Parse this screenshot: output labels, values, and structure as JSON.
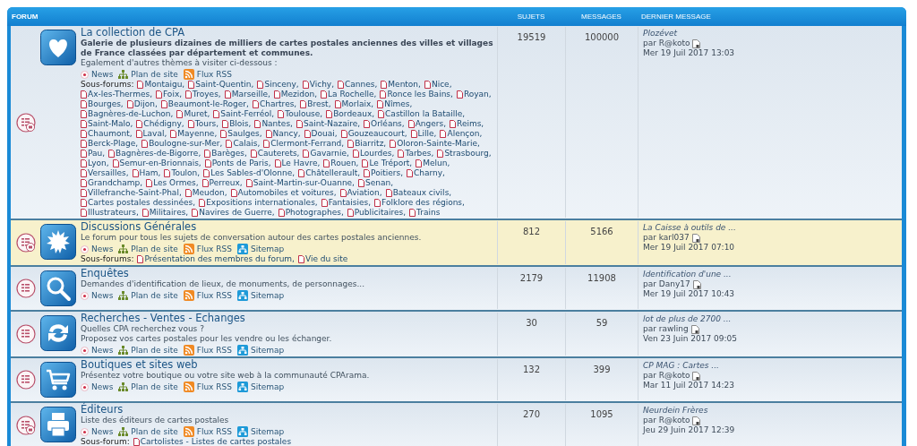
{
  "header": {
    "forum": "FORUM",
    "topics": "SUJETS",
    "posts": "MESSAGES",
    "last_post": "DERNIER MESSAGE"
  },
  "forums": [
    {
      "name": "La collection de CPA",
      "highlighted": false,
      "has_subforums": true,
      "description": [
        {
          "kind": "bold",
          "text": "Galerie de plusieurs dizaines de milliers de cartes postales anciennes des villes et villages de France classées par département et communes."
        },
        {
          "kind": "plain",
          "text": "Egalement d'autres thèmes à visiter ci-dessous :"
        }
      ],
      "links": [
        {
          "kind": "news",
          "label": "News"
        },
        {
          "kind": "plan",
          "label": "Plan de site"
        },
        {
          "kind": "rss",
          "label": "Flux RSS"
        }
      ],
      "subforums_label": "Sous-forums:",
      "subforums": [
        "Montaigu,",
        "Saint-Quentin,",
        "Sinceny,",
        "Vichy,",
        "Cannes,",
        "Menton,",
        "Nice,",
        "Ax-les-Thermes,",
        "Foix,",
        "Troyes,",
        "Marseille,",
        "Mezidon,",
        "La Rochelle,",
        "Ronce les Bains,",
        "Royan,",
        "Bourges,",
        "Dijon,",
        "Beaumont-le-Roger,",
        "Chartres,",
        "Brest,",
        "Morlaix,",
        "Nîmes,",
        "Bagnères-de-Luchon,",
        "Muret,",
        "Saint-Ferréol,",
        "Toulouse,",
        "Bordeaux,",
        "Castillon la Bataille,",
        "Saint-Malo,",
        "Chédigny,",
        "Tours,",
        "Blois,",
        "Nantes,",
        "Saint-Nazaire,",
        "Orléans,",
        "Angers,",
        "Reims,",
        "Chaumont,",
        "Laval,",
        "Mayenne,",
        "Saulges,",
        "Nancy,",
        "Douai,",
        "Gouzeaucourt,",
        "Lille,",
        "Alençon,",
        "Berck-Plage,",
        "Boulogne-sur-Mer,",
        "Calais,",
        "Clermont-Ferrand,",
        "Biarritz,",
        "Oloron-Sainte-Marie,",
        "Pau,",
        "Bagnères-de-Bigorre,",
        "Barèges,",
        "Cauterets,",
        "Gavarnie,",
        "Lourdes,",
        "Tarbes,",
        "Strasbourg,",
        "Lyon,",
        "Semur-en-Brionnais,",
        "Ponts de Paris,",
        "Le Havre,",
        "Rouen,",
        "Le Tréport,",
        "Melun,",
        "Versailles,",
        "Ham,",
        "Toulon,",
        "Les Sables-d'Olonne,",
        "Châtellerault,",
        "Poitiers,",
        "Charny,",
        "Grandchamp,",
        "Les Ormes,",
        "Perreux,",
        "Saint-Martin-sur-Ouanne,",
        "Senan,",
        "Villefranche-Saint-Phal,",
        "Meudon,",
        "Automobiles et voitures,",
        "Aviation,",
        "Bateaux civils,",
        "Cartes postales dessinées,",
        "Expositions internationales,",
        "Fantaisies,",
        "Folklore des régions,",
        "Illustrateurs,",
        "Militaires,",
        "Navires de Guerre,",
        "Photographes,",
        "Publicitaires,",
        "Trains"
      ],
      "topics": "19519",
      "posts": "100000",
      "last": {
        "title": "Plozévet",
        "author": "par R@koto",
        "date": "Mer 19 Juil 2017 13:03"
      }
    },
    {
      "name": "Discussions Générales",
      "highlighted": true,
      "has_subforums": true,
      "description": [
        {
          "kind": "plain",
          "text": "Le forum pour tous les sujets de conversation autour des cartes postales anciennes."
        }
      ],
      "links": [
        {
          "kind": "news",
          "label": "News"
        },
        {
          "kind": "plan",
          "label": "Plan de site"
        },
        {
          "kind": "rss",
          "label": "Flux RSS"
        },
        {
          "kind": "sitemap",
          "label": "Sitemap"
        }
      ],
      "subforums_label": "Sous-forums:",
      "subforums": [
        "Présentation des membres du forum,",
        "Vie du site"
      ],
      "topics": "812",
      "posts": "5166",
      "last": {
        "title": "La Caisse à outils de ...",
        "author": "par karl037",
        "date": "Mer 19 Juil 2017 07:10"
      }
    },
    {
      "name": "Enquêtes",
      "highlighted": false,
      "has_subforums": false,
      "description": [
        {
          "kind": "plain",
          "text": "Demandes d'identification de lieux, de monuments, de personnages..."
        }
      ],
      "links": [
        {
          "kind": "news",
          "label": "News"
        },
        {
          "kind": "plan",
          "label": "Plan de site"
        },
        {
          "kind": "rss",
          "label": "Flux RSS"
        },
        {
          "kind": "sitemap",
          "label": "Sitemap"
        }
      ],
      "topics": "2179",
      "posts": "11908",
      "last": {
        "title": "Identification d'une ...",
        "author": "par Dany17",
        "date": "Mer 19 Juil 2017 10:43"
      }
    },
    {
      "name": "Recherches - Ventes - Echanges",
      "highlighted": false,
      "has_subforums": false,
      "description": [
        {
          "kind": "plain",
          "text": "Quelles CPA recherchez vous ?"
        },
        {
          "kind": "plain",
          "text": "Proposez vos cartes postales pour les vendre ou les échanger."
        }
      ],
      "links": [
        {
          "kind": "news",
          "label": "News"
        },
        {
          "kind": "plan",
          "label": "Plan de site"
        },
        {
          "kind": "rss",
          "label": "Flux RSS"
        },
        {
          "kind": "sitemap",
          "label": "Sitemap"
        }
      ],
      "topics": "30",
      "posts": "59",
      "last": {
        "title": "lot de plus de 2700 ...",
        "author": "par rawling",
        "date": "Ven 23 Juin 2017 09:05"
      }
    },
    {
      "name": "Boutiques et sites web",
      "highlighted": false,
      "has_subforums": false,
      "description": [
        {
          "kind": "plain",
          "text": "Présentez votre boutique ou votre site web à la communauté CPArama."
        }
      ],
      "links": [
        {
          "kind": "news",
          "label": "News"
        },
        {
          "kind": "plan",
          "label": "Plan de site"
        },
        {
          "kind": "rss",
          "label": "Flux RSS"
        },
        {
          "kind": "sitemap",
          "label": "Sitemap"
        }
      ],
      "topics": "132",
      "posts": "399",
      "last": {
        "title": "CP MAG : Cartes ...",
        "author": "par R@koto",
        "date": "Mar 11 Juil 2017 14:23"
      }
    },
    {
      "name": "Éditeurs",
      "highlighted": false,
      "has_subforums": true,
      "description": [
        {
          "kind": "plain",
          "text": "Liste des éditeurs de cartes postales"
        }
      ],
      "links": [
        {
          "kind": "news",
          "label": "News"
        },
        {
          "kind": "plan",
          "label": "Plan de site"
        },
        {
          "kind": "rss",
          "label": "Flux RSS"
        },
        {
          "kind": "sitemap",
          "label": "Sitemap"
        }
      ],
      "subforums_label": "Sous-forum:",
      "subforums": [
        "Cartolistes - Listes de cartes postales"
      ],
      "topics": "270",
      "posts": "1095",
      "last": {
        "title": "Neurdein Frères",
        "author": "par R@koto",
        "date": "Jeu 29 Juin 2017 12:39"
      }
    }
  ]
}
